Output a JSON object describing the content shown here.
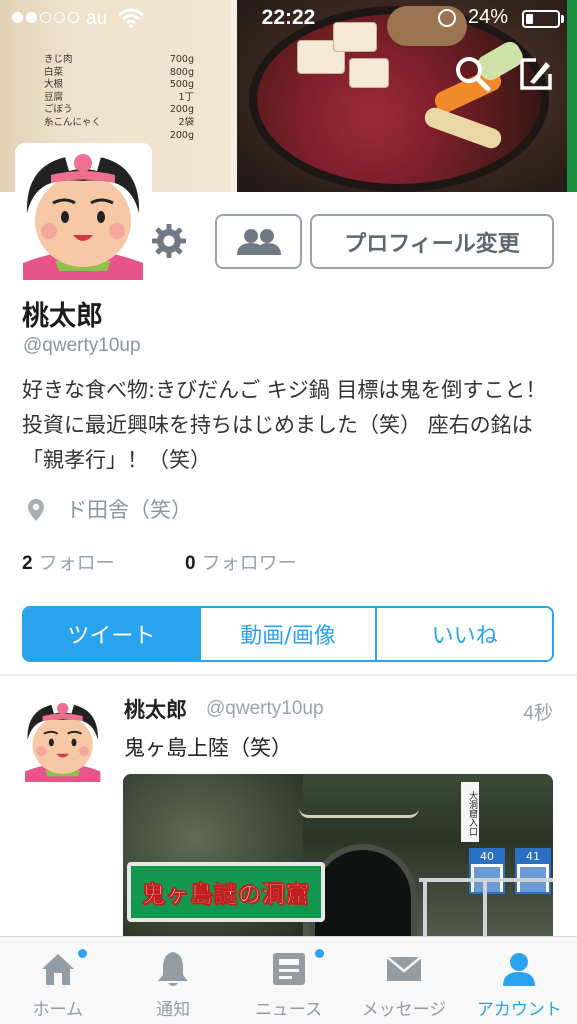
{
  "status_bar": {
    "carrier": "au",
    "time": "22:22",
    "battery": "24%",
    "battery_level": 0.24
  },
  "header_image": {
    "recipe": [
      {
        "item": "きじ肉",
        "amount": "700g"
      },
      {
        "item": "白菜",
        "amount": "800g"
      },
      {
        "item": "大根",
        "amount": "500g"
      },
      {
        "item": "豆腐",
        "amount": "1丁"
      },
      {
        "item": "ごぼう",
        "amount": "200g"
      },
      {
        "item": "糸こんにゃく",
        "amount": "2袋"
      },
      {
        "item": "",
        "amount": "200g"
      }
    ]
  },
  "profile": {
    "edit_button": "プロフィール変更",
    "name": "桃太郎",
    "handle": "@qwerty10up",
    "bio": "好きな食べ物:きびだんご キジ鍋 目標は鬼を倒すこと！投資に最近興味を持ちはじめました（笑） 座右の銘は「親孝行」！（笑）",
    "location": "ド田舎（笑）",
    "following_count": "2",
    "following_label": "フォロー",
    "followers_count": "0",
    "followers_label": "フォロワー"
  },
  "tabs": [
    {
      "label": "ツイート",
      "active": true
    },
    {
      "label": "動画/画像",
      "active": false
    },
    {
      "label": "いいね",
      "active": false
    }
  ],
  "tweet": {
    "name": "桃太郎",
    "handle": "@qwerty10up",
    "time": "4秒",
    "text": "鬼ヶ島上陸（笑）",
    "image_sign": "鬼ヶ島謎の洞窟",
    "image_post_sign": "大洞窟入口",
    "image_num_signs": [
      "40",
      "41"
    ]
  },
  "tab_bar": [
    {
      "label": "ホーム",
      "icon": "home-icon",
      "badge": true,
      "active": false
    },
    {
      "label": "通知",
      "icon": "bell-icon",
      "badge": false,
      "active": false
    },
    {
      "label": "ニュース",
      "icon": "news-icon",
      "badge": true,
      "active": false
    },
    {
      "label": "メッセージ",
      "icon": "envelope-icon",
      "badge": false,
      "active": false
    },
    {
      "label": "アカウント",
      "icon": "person-icon",
      "badge": false,
      "active": true
    }
  ],
  "colors": {
    "accent": "#2aa3ef",
    "muted": "#8b959e"
  }
}
